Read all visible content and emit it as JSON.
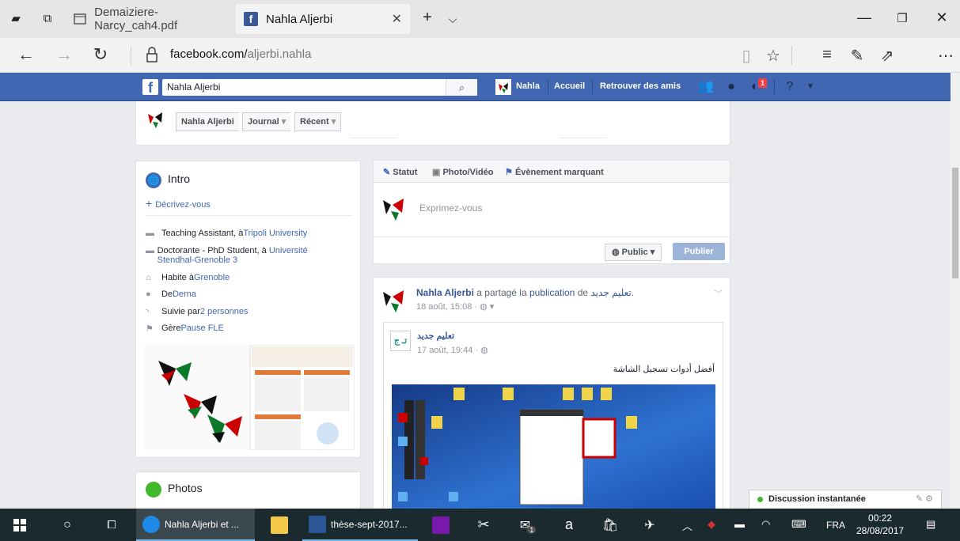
{
  "browser": {
    "tabs": [
      {
        "label": "Demaiziere-Narcy_cah4.pdf"
      },
      {
        "label": "Nahla Aljerbi"
      }
    ],
    "url_domain": "facebook.com/",
    "url_path": "aljerbi.nahla"
  },
  "fb_header": {
    "search_value": "Nahla Aljerbi",
    "profile_name": "Nahla",
    "home": "Accueil",
    "find_friends": "Retrouver des amis",
    "notifications_count": "1"
  },
  "profile_nav": {
    "name": "Nahla Aljerbi",
    "timeline": "Journal",
    "recent": "Récent"
  },
  "intro": {
    "title": "Intro",
    "describe": "Décrivez-vous",
    "rows": [
      {
        "prefix": "Teaching Assistant, à ",
        "link": "Tripoli University"
      },
      {
        "prefix": "Doctorante - PhD Student, à ",
        "link": "Université Stendhal-Grenoble 3"
      },
      {
        "prefix": "Habite à ",
        "link": "Grenoble"
      },
      {
        "prefix": "De ",
        "link": "Derna"
      },
      {
        "prefix": "Suivie par ",
        "link": "2 personnes"
      },
      {
        "prefix": "Gère ",
        "link": "Pause FLE"
      }
    ]
  },
  "photos": {
    "title": "Photos"
  },
  "composer": {
    "tab_status": "Statut",
    "tab_photo": "Photo/Vidéo",
    "tab_event": "Évènement marquant",
    "placeholder": "Exprimez-vous",
    "audience": "Public",
    "publish": "Publier"
  },
  "post": {
    "author": "Nahla Aljerbi",
    "shared_text": " a partagé la ",
    "publication": "publication",
    "de": " de ",
    "source": "تعليم جديد",
    "time": "18 août, 15:08 ·",
    "shared_name": "تعليم جديد",
    "shared_time": "17 août, 19:44 ·",
    "shared_body": "أفضل أدوات تسجيل الشاشة",
    "logo_text": "تـ ج"
  },
  "chat": {
    "label": "Discussion instantanée"
  },
  "taskbar": {
    "edge_label": "Nahla Aljerbi et ...",
    "word_label": "thèse-sept-2017...",
    "lang": "FRA",
    "time": "00:22",
    "date": "28/08/2017",
    "mail_count": "1"
  }
}
